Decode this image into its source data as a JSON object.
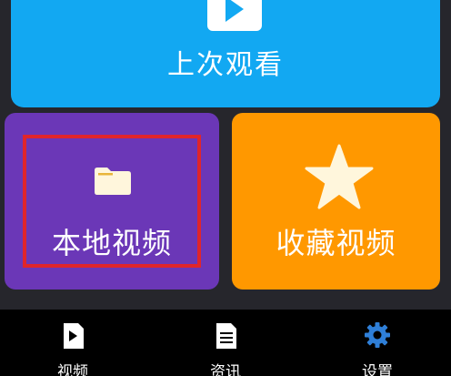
{
  "tiles": {
    "last_watched": {
      "label": "上次观看",
      "color": "#12a8f2",
      "icon": "play-icon"
    },
    "local_videos": {
      "label": "本地视频",
      "color": "#6b37b7",
      "icon": "folder-icon"
    },
    "favorite_videos": {
      "label": "收藏视频",
      "color": "#ff9800",
      "icon": "star-icon"
    }
  },
  "highlight": {
    "color": "#e0252b",
    "target": "local_videos"
  },
  "bottom_nav": {
    "items": [
      {
        "label": "视频",
        "icon": "play-doc-icon",
        "active": false
      },
      {
        "label": "资讯",
        "icon": "document-icon",
        "active": false
      },
      {
        "label": "设置",
        "icon": "gear-icon",
        "active": true
      }
    ],
    "active_color": "#2f7fd8"
  }
}
